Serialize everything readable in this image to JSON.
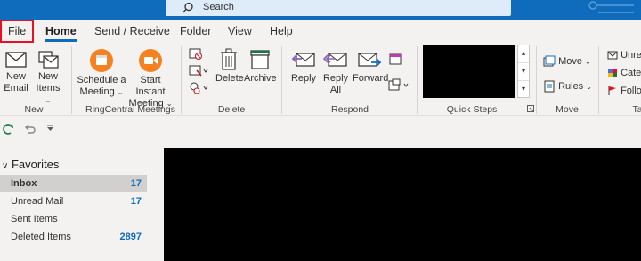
{
  "search": {
    "placeholder": "Search"
  },
  "tabs": [
    "File",
    "Home",
    "Send / Receive",
    "Folder",
    "View",
    "Help"
  ],
  "ribbon": {
    "new_group": {
      "label": "New",
      "new_email": [
        "New",
        "Email"
      ],
      "new_items": [
        "New",
        "Items"
      ]
    },
    "ringcentral_group": {
      "label": "RingCentral Meetings",
      "schedule": [
        "Schedule a",
        "Meeting"
      ],
      "start": [
        "Start Instant",
        "Meeting"
      ]
    },
    "delete_group": {
      "label": "Delete",
      "delete": "Delete",
      "archive": "Archive"
    },
    "respond_group": {
      "label": "Respond",
      "reply": "Reply",
      "reply_all": [
        "Reply",
        "All"
      ],
      "forward": "Forward"
    },
    "quicksteps_group": {
      "label": "Quick Steps"
    },
    "move_group": {
      "label": "Move",
      "move": "Move",
      "rules": "Rules"
    },
    "tags_group": {
      "label": "Ta",
      "unread": "Unre",
      "categorize": "Categ",
      "follow": "Follo"
    }
  },
  "folders": {
    "favorites_label": "Favorites",
    "items": [
      {
        "name": "Inbox",
        "count": "17"
      },
      {
        "name": "Unread Mail",
        "count": "17"
      },
      {
        "name": "Sent Items",
        "count": ""
      },
      {
        "name": "Deleted Items",
        "count": "2897"
      }
    ]
  },
  "colors": {
    "accent": "#0f6cbd",
    "file_highlight": "#e81123",
    "ringcentral": "#f58220"
  }
}
